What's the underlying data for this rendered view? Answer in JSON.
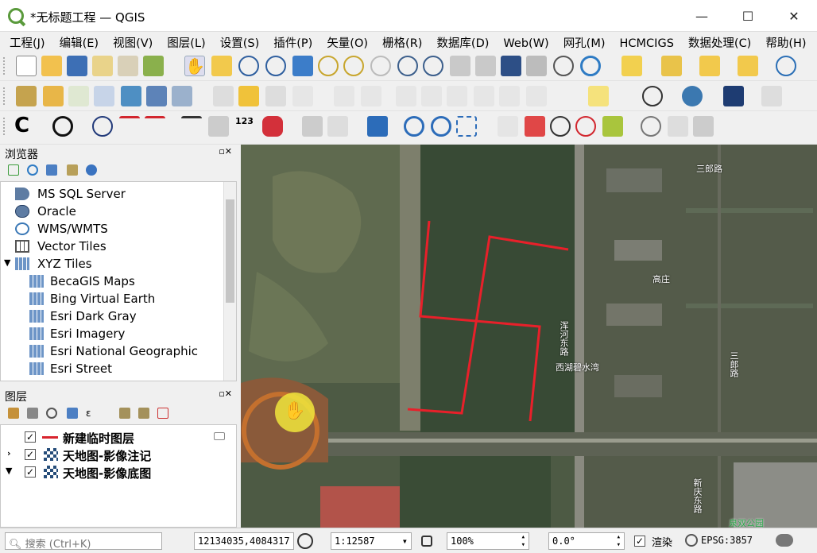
{
  "window": {
    "title": "*无标题工程 — QGIS",
    "min": "—",
    "max": "☐",
    "close": "✕"
  },
  "menu": [
    "工程(J)",
    "编辑(E)",
    "视图(V)",
    "图层(L)",
    "设置(S)",
    "插件(P)",
    "矢量(O)",
    "栅格(R)",
    "数据库(D)",
    "Web(W)",
    "网孔(M)",
    "HCMCIGS",
    "数据处理(C)",
    "帮助(H)"
  ],
  "browser": {
    "title": "浏览器",
    "items": [
      {
        "label": "MS SQL Server",
        "icon": "mssql-icon",
        "indent": 0
      },
      {
        "label": "Oracle",
        "icon": "oracle-icon",
        "indent": 0
      },
      {
        "label": "WMS/WMTS",
        "icon": "wms-icon",
        "indent": 0
      },
      {
        "label": "Vector Tiles",
        "icon": "vector-tiles-icon",
        "indent": 0
      },
      {
        "label": "XYZ Tiles",
        "icon": "xyz-tiles-icon",
        "indent": 0
      },
      {
        "label": "BecaGIS Maps",
        "icon": "xyz-layer-icon",
        "indent": 1
      },
      {
        "label": "Bing Virtual Earth",
        "icon": "xyz-layer-icon",
        "indent": 1
      },
      {
        "label": "Esri Dark Gray",
        "icon": "xyz-layer-icon",
        "indent": 1
      },
      {
        "label": "Esri Imagery",
        "icon": "xyz-layer-icon",
        "indent": 1
      },
      {
        "label": "Esri National Geographic",
        "icon": "xyz-layer-icon",
        "indent": 1
      },
      {
        "label": "Esri Street",
        "icon": "xyz-layer-icon",
        "indent": 1
      }
    ]
  },
  "layers": {
    "title": "图层",
    "items": [
      {
        "label": "新建临时图层",
        "checked": true,
        "icon": "line-symbol-icon"
      },
      {
        "label": "天地图-影像注记",
        "checked": true,
        "icon": "raster-layer-icon"
      },
      {
        "label": "天地图-影像底图",
        "checked": true,
        "icon": "raster-layer-icon"
      }
    ]
  },
  "map": {
    "labels": [
      {
        "text": "三郎路"
      },
      {
        "text": "高庄"
      },
      {
        "text": "三郎路"
      },
      {
        "text": "浑河东路"
      },
      {
        "text": "西湖碧水湾"
      },
      {
        "text": "新庆东路"
      },
      {
        "text": "泉双公园"
      }
    ],
    "line_color": "#e8202a"
  },
  "status": {
    "search_placeholder": "搜索 (Ctrl+K)",
    "coordinate": "12134035,4084317",
    "scale": "1:12587",
    "magnifier": "100%",
    "rotation": "0.0°",
    "render_label": "渲染",
    "render_checked": true,
    "crs": "EPSG:3857"
  }
}
